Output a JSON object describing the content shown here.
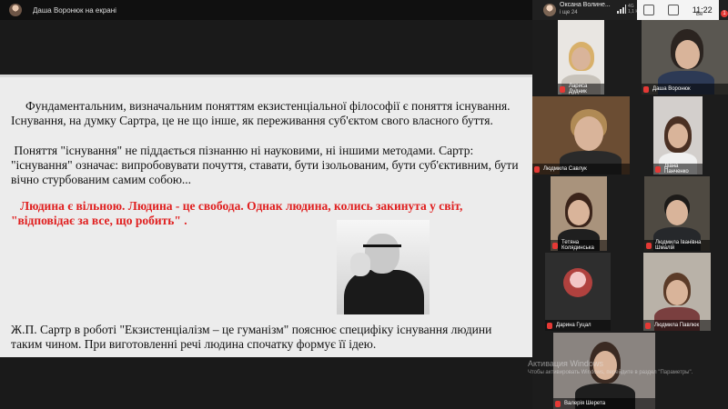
{
  "top_bar": {
    "presenter_label": "Даша Воронюк на екрані"
  },
  "status_bar": {
    "user_name": "Оксана Волине...",
    "user_sub": "і ще 24",
    "network": "4G\n1,1 КБ/с",
    "time": "11:22",
    "corner_text": "Ве",
    "badge": "1"
  },
  "slide": {
    "paragraph_1": "Фундаментальним, визначальним поняттям екзистенціальної філософії є поняття існування. Існування, на думку Сартра, це не що інше, як переживання суб'єктом свого власного буття.",
    "paragraph_2": " Поняття \"існування\" не піддається пізнанню ні науковими, ні іншими методами. Сартр: \"існування\" означає: випробовувати почуття, ставати, бути ізольованим, бути суб'єктивним, бути вічно стурбованим самим собою...",
    "quote": "   Людина є вільною. Людина - це свобода. Однак людина, колись закинута у світ, \"відповідає за все, що робить\" .",
    "paragraph_3": "Ж.П. Сартр в роботі \"Екзистенціалізм – це гуманізм\" пояснює специфіку існування людини таким чином. При виготовленні речі людина спочатку формує її ідею."
  },
  "participants": [
    {
      "name": "Лариса Дудник"
    },
    {
      "name": "Даша Воронюк"
    },
    {
      "name": "Людмила Савлук"
    },
    {
      "name": "Діана Панченко"
    },
    {
      "name": "Тетяна Колядинська"
    },
    {
      "name": "Людмила Іванівна Шмалій"
    },
    {
      "name": "Дарина Гуцал"
    },
    {
      "name": "Людмила Павлюк"
    },
    {
      "name": "Валерія Шерета"
    }
  ],
  "watermark": {
    "title": "Активация Windows",
    "subtitle": "Чтобы активировать Windows, перейдите в раздел \"Параметры\"."
  }
}
